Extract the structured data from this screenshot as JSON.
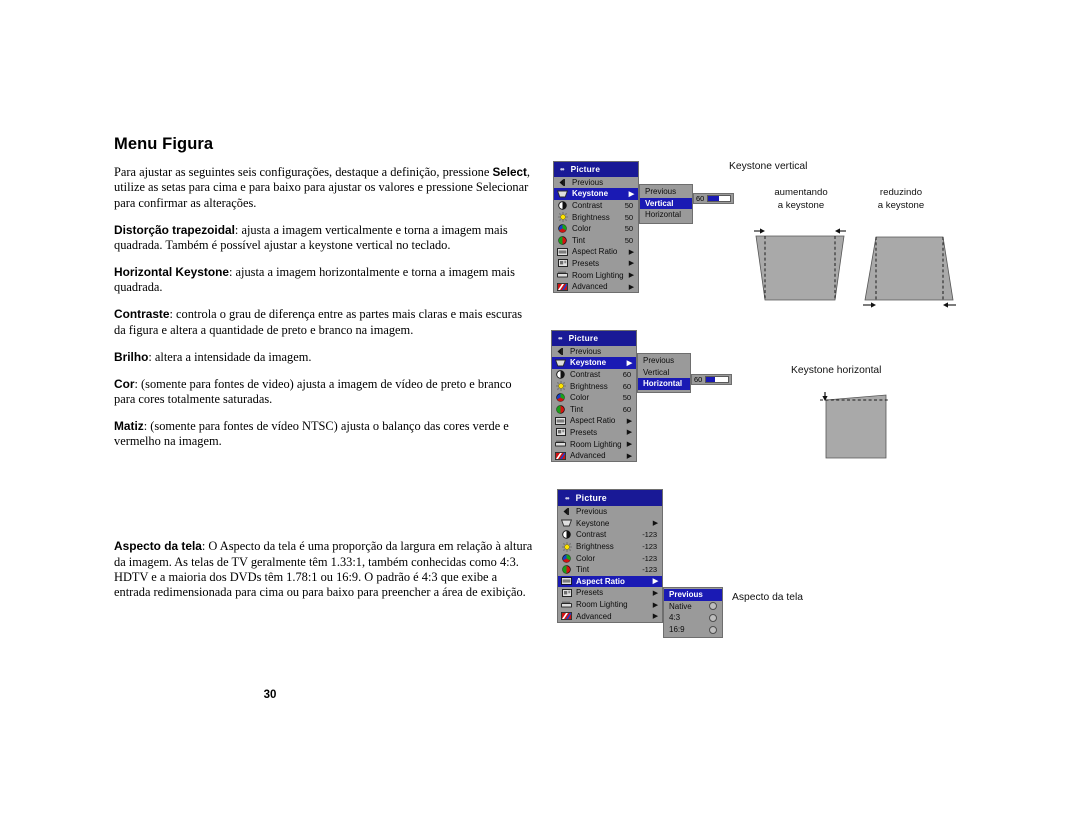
{
  "document": {
    "title": "Menu Figura",
    "page_number": "30"
  },
  "body_text": {
    "intro": {
      "before": "Para ajustar as seguintes seis configurações, destaque a definição, pressione ",
      "bold": "Select",
      "after": ", utilize as setas para cima e para baixo para ajustar os valores e pressione Selecionar para confirmar as alterações."
    },
    "items": [
      {
        "term": "Distorção trapezoidal",
        "desc": ": ajusta a imagem verticalmente e torna a imagem mais quadrada. Também é possível ajustar a keystone vertical no teclado."
      },
      {
        "term": "Horizontal Keystone",
        "desc": ": ajusta a imagem horizontalmente e torna a imagem mais quadrada."
      },
      {
        "term": "Contraste",
        "desc": ": controla o grau de diferença entre as partes mais claras e mais escuras da figura e altera a quantidade de preto e branco na imagem."
      },
      {
        "term": "Brilho",
        "desc": ": altera a intensidade da imagem."
      },
      {
        "term": "Cor",
        "desc": ": (somente para fontes de video) ajusta a imagem de vídeo de preto e branco para cores totalmente saturadas."
      },
      {
        "term": "Matiz",
        "desc": ": (somente para fontes de vídeo NTSC) ajusta o balanço das cores verde e vermelho na imagem."
      }
    ],
    "aspect_item": {
      "term": "Aspecto da tela",
      "desc": ": O Aspecto da tela é uma proporção da largura em relação à altura da imagem. As telas de TV geralmente têm 1.33:1, também conhecidas como 4:3. HDTV e a maioria dos DVDs têm 1.78:1 ou 16:9. O padrão é 4:3 que exibe a entrada redimensionada para cima ou para baixo para preencher a área de exibição."
    }
  },
  "osd_menu_1": {
    "title": "Picture",
    "rows": [
      {
        "icon": "back-arrow-icon",
        "label": "Previous",
        "value": "",
        "arrow": "",
        "selected": false
      },
      {
        "icon": "keystone-icon",
        "label": "Keystone",
        "value": "",
        "arrow": "▶",
        "selected": true
      },
      {
        "icon": "contrast-icon",
        "label": "Contrast",
        "value": "50",
        "arrow": "",
        "selected": false
      },
      {
        "icon": "brightness-icon",
        "label": "Brightness",
        "value": "50",
        "arrow": "",
        "selected": false
      },
      {
        "icon": "color-icon",
        "label": "Color",
        "value": "50",
        "arrow": "",
        "selected": false
      },
      {
        "icon": "tint-icon",
        "label": "Tint",
        "value": "50",
        "arrow": "",
        "selected": false
      },
      {
        "icon": "aspect-ratio-icon",
        "label": "Aspect Ratio",
        "value": "",
        "arrow": "▶",
        "selected": false
      },
      {
        "icon": "presets-icon",
        "label": "Presets",
        "value": "",
        "arrow": "▶",
        "selected": false
      },
      {
        "icon": "room-lighting-icon",
        "label": "Room Lighting",
        "value": "",
        "arrow": "▶",
        "selected": false
      },
      {
        "icon": "advanced-icon",
        "label": "Advanced",
        "value": "",
        "arrow": "▶",
        "selected": false
      }
    ],
    "submenu": [
      {
        "label": "Previous",
        "selected": false
      },
      {
        "label": "Vertical",
        "selected": true
      },
      {
        "label": "Horizontal",
        "selected": false
      }
    ],
    "slider": {
      "value": "60",
      "fill_percent": 50
    }
  },
  "osd_menu_2": {
    "title": "Picture",
    "rows": [
      {
        "icon": "back-arrow-icon",
        "label": "Previous",
        "value": "",
        "arrow": "",
        "selected": false
      },
      {
        "icon": "keystone-icon",
        "label": "Keystone",
        "value": "",
        "arrow": "▶",
        "selected": true
      },
      {
        "icon": "contrast-icon",
        "label": "Contrast",
        "value": "60",
        "arrow": "",
        "selected": false
      },
      {
        "icon": "brightness-icon",
        "label": "Brightness",
        "value": "60",
        "arrow": "",
        "selected": false
      },
      {
        "icon": "color-icon",
        "label": "Color",
        "value": "50",
        "arrow": "",
        "selected": false
      },
      {
        "icon": "tint-icon",
        "label": "Tint",
        "value": "60",
        "arrow": "",
        "selected": false
      },
      {
        "icon": "aspect-ratio-icon",
        "label": "Aspect Ratio",
        "value": "",
        "arrow": "▶",
        "selected": false
      },
      {
        "icon": "presets-icon",
        "label": "Presets",
        "value": "",
        "arrow": "▶",
        "selected": false
      },
      {
        "icon": "room-lighting-icon",
        "label": "Room Lighting",
        "value": "",
        "arrow": "▶",
        "selected": false
      },
      {
        "icon": "advanced-icon",
        "label": "Advanced",
        "value": "",
        "arrow": "▶",
        "selected": false
      }
    ],
    "submenu": [
      {
        "label": "Previous",
        "selected": false
      },
      {
        "label": "Vertical",
        "selected": false
      },
      {
        "label": "Horizontal",
        "selected": true
      }
    ],
    "slider": {
      "value": "60",
      "fill_percent": 42
    }
  },
  "osd_menu_3": {
    "title": "Picture",
    "rows": [
      {
        "icon": "back-arrow-icon",
        "label": "Previous",
        "value": "",
        "arrow": "",
        "selected": false
      },
      {
        "icon": "keystone-icon",
        "label": "Keystone",
        "value": "",
        "arrow": "▶",
        "selected": false
      },
      {
        "icon": "contrast-icon",
        "label": "Contrast",
        "value": "-123",
        "arrow": "",
        "selected": false
      },
      {
        "icon": "brightness-icon",
        "label": "Brightness",
        "value": "-123",
        "arrow": "",
        "selected": false
      },
      {
        "icon": "color-icon",
        "label": "Color",
        "value": "-123",
        "arrow": "",
        "selected": false
      },
      {
        "icon": "tint-icon",
        "label": "Tint",
        "value": "-123",
        "arrow": "",
        "selected": false
      },
      {
        "icon": "aspect-ratio-icon",
        "label": "Aspect Ratio",
        "value": "",
        "arrow": "▶",
        "selected": true
      },
      {
        "icon": "presets-icon",
        "label": "Presets",
        "value": "",
        "arrow": "▶",
        "selected": false
      },
      {
        "icon": "room-lighting-icon",
        "label": "Room Lighting",
        "value": "",
        "arrow": "▶",
        "selected": false
      },
      {
        "icon": "advanced-icon",
        "label": "Advanced",
        "value": "",
        "arrow": "▶",
        "selected": false
      }
    ],
    "submenu": [
      {
        "label": "Previous",
        "selected": true,
        "radio": false
      },
      {
        "label": "Native",
        "selected": false,
        "radio": true
      },
      {
        "label": "4:3",
        "selected": false,
        "radio": true
      },
      {
        "label": "16:9",
        "selected": false,
        "radio": true
      }
    ]
  },
  "figures": {
    "keystone_vertical": {
      "label": "Keystone vertical",
      "caption_left_line1": "aumentando",
      "caption_left_line2": "a keystone",
      "caption_right_line1": "reduzindo",
      "caption_right_line2": "a keystone"
    },
    "keystone_horizontal": {
      "label": "Keystone horizontal"
    },
    "aspect_ratio": {
      "label": "Aspecto da tela"
    }
  },
  "colors": {
    "menu_title_bg": "#191996",
    "menu_body_bg": "#9a9a9a",
    "selection_blue": "#1a1ab4",
    "shape_fill": "#a9a9a9",
    "shape_stroke": "#4d4d4d"
  }
}
